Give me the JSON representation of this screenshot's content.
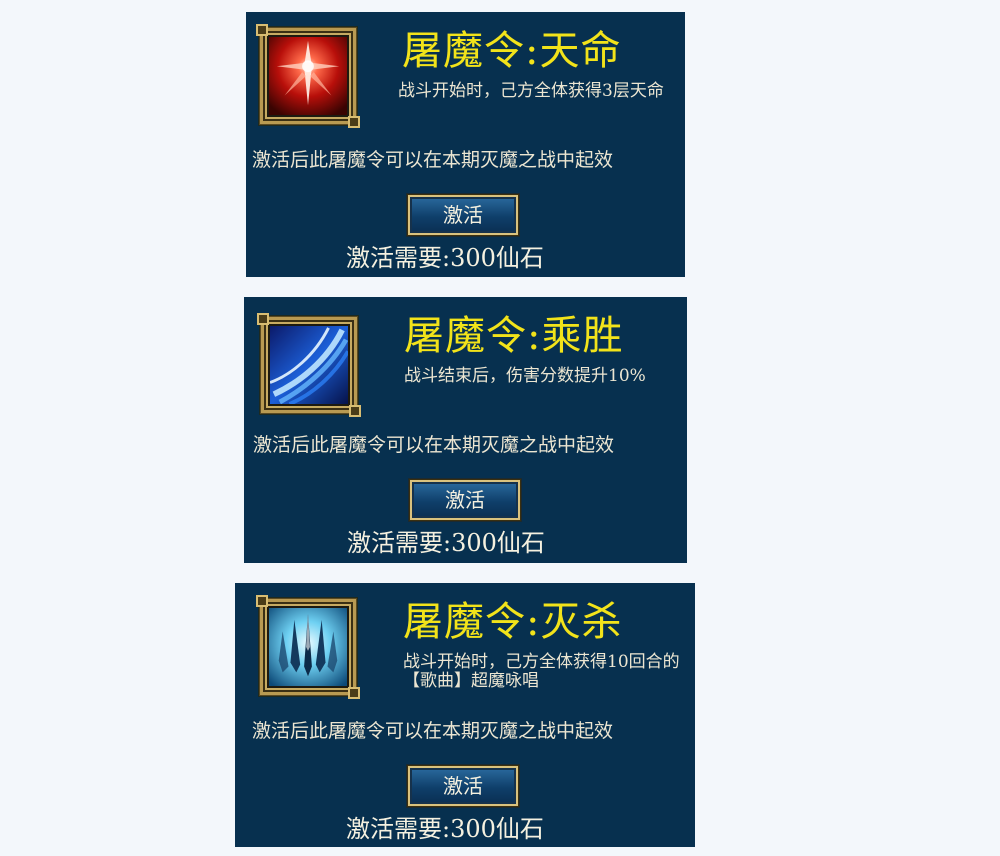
{
  "cards": [
    {
      "title": "屠魔令:天命",
      "icon": "crimson-sword-burst-icon",
      "description": "战斗开始时，己方全体获得3层天命",
      "note": "激活后此屠魔令可以在本期灭魔之战中起效",
      "button_label": "激活",
      "cost": "激活需要:300仙石"
    },
    {
      "title": "屠魔令:乘胜",
      "icon": "blue-slash-wave-icon",
      "description": "战斗结束后，伤害分数提升10%",
      "note": "激活后此屠魔令可以在本期灭魔之战中起效",
      "button_label": "激活",
      "cost": "激活需要:300仙石"
    },
    {
      "title": "屠魔令:灭杀",
      "icon": "ice-blades-icon",
      "description": "战斗开始时，己方全体获得10回合的【歌曲】超魔咏唱",
      "note": "激活后此屠魔令可以在本期灭魔之战中起效",
      "button_label": "激活",
      "cost": "激活需要:300仙石"
    }
  ],
  "colors": {
    "panel_background": "#07304f",
    "title": "#f2e31a",
    "text": "#ece6d2",
    "frame_gold": "#b89a52"
  }
}
